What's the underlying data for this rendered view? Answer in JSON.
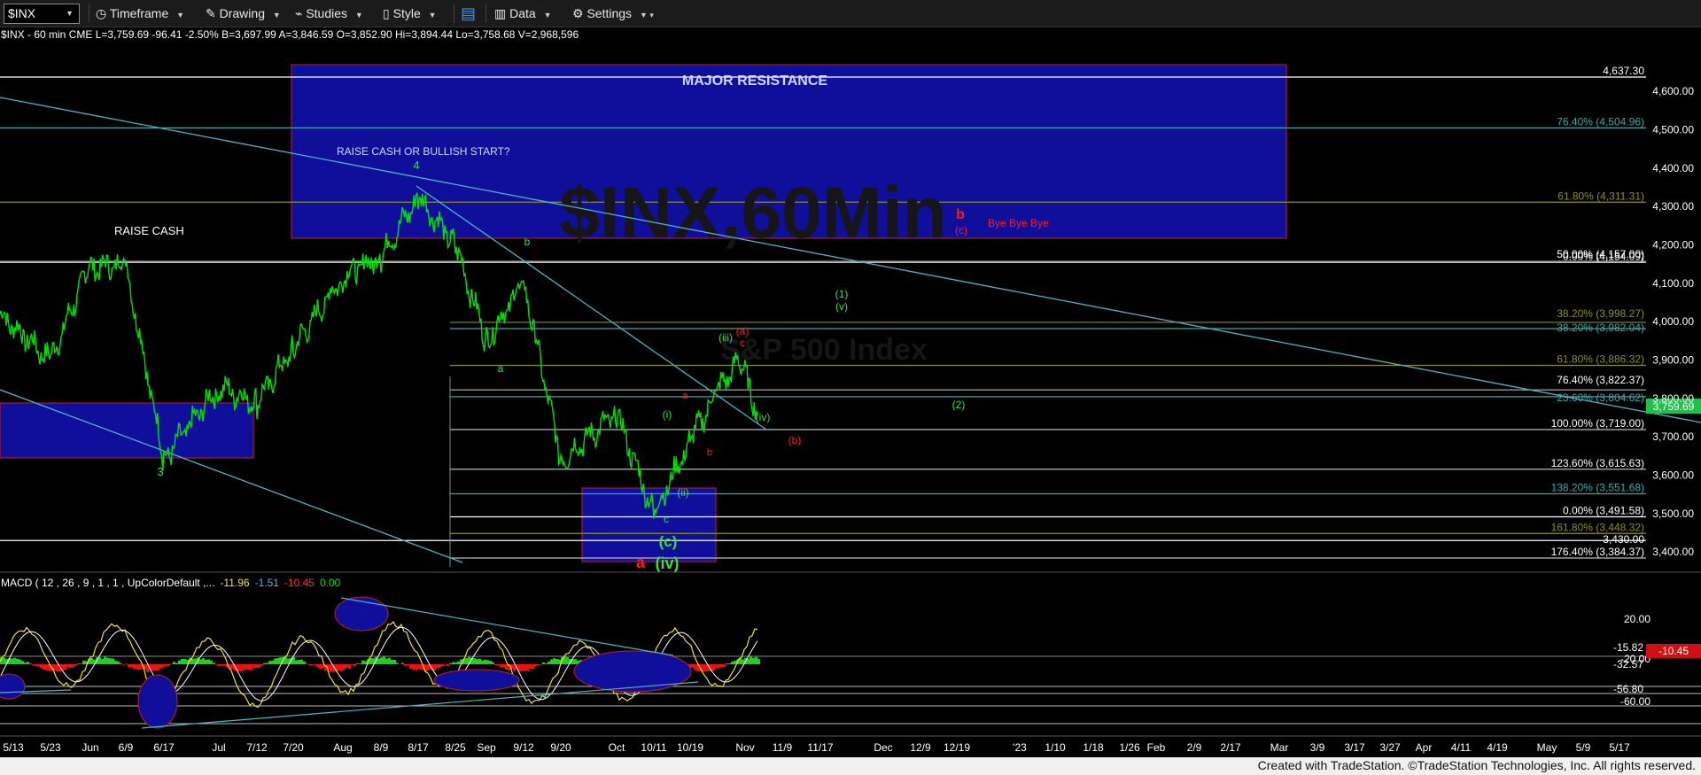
{
  "toolbar": {
    "symbol": "$INX",
    "timeframe": "Timeframe",
    "drawing": "Drawing",
    "studies": "Studies",
    "style": "Style",
    "data": "Data",
    "settings": "Settings"
  },
  "quote_line": "$INX - 60 min  CME  L=3,759.69  -96.41  -2.50%  B=3,697.99  A=3,846.59  O=3,852.90  Hi=3,894.44  Lo=3,758.68  V=2,968,596",
  "watermark": {
    "title": "$INX,60Min",
    "subtitle": "S&P 500 Index"
  },
  "colors": {
    "background": "#000000",
    "price": "#00e000",
    "resistance_box": "#0f0f9c",
    "trendline": "#4fb3c4",
    "fib_teal": "#3ca6a6",
    "fib_olive": "#8c8c2a",
    "label_red": "#ff1a1a",
    "label_green": "#3cdc3c",
    "current_price": "#1cc24a",
    "macd_line": "#f0e040",
    "signal_line": "#ffffff",
    "hist_pos": "#22cc22",
    "hist_neg": "#ee1111"
  },
  "chart_data": {
    "type": "line",
    "title": "$INX - 60 min",
    "series": [
      {
        "name": "$INX",
        "x": [
          "5/13",
          "5/23",
          "6/1",
          "6/9",
          "6/17",
          "7/1",
          "7/12",
          "7/20",
          "8/1",
          "8/9",
          "8/17",
          "8/25",
          "9/1",
          "9/12",
          "9/20",
          "10/1",
          "10/11",
          "10/19",
          "10/24",
          "10/31",
          "11/4"
        ],
        "values": [
          4020,
          3900,
          4140,
          4150,
          3640,
          3830,
          3790,
          3930,
          4120,
          4170,
          4325,
          4200,
          3950,
          4105,
          3640,
          3760,
          3500,
          3690,
          3820,
          3900,
          3759.69
        ]
      }
    ],
    "current_price": "3,759.69",
    "ylim": [
      3330,
      4700
    ],
    "y_ticks": [
      {
        "label": "4,600.00",
        "value": 4600
      },
      {
        "label": "4,500.00",
        "value": 4500
      },
      {
        "label": "4,400.00",
        "value": 4400
      },
      {
        "label": "4,300.00",
        "value": 4300
      },
      {
        "label": "4,200.00",
        "value": 4200
      },
      {
        "label": "4,100.00",
        "value": 4100
      },
      {
        "label": "4,000.00",
        "value": 4000
      },
      {
        "label": "3,900.00",
        "value": 3900
      },
      {
        "label": "3,800.00",
        "value": 3800
      },
      {
        "label": "3,700.00",
        "value": 3700
      },
      {
        "label": "3,600.00",
        "value": 3600
      },
      {
        "label": "3,500.00",
        "value": 3500
      },
      {
        "label": "3,400.00",
        "value": 3400
      }
    ],
    "x_ticks": [
      "5/13",
      "5/23",
      "Jun",
      "6/9",
      "6/17",
      "Jul",
      "7/12",
      "7/20",
      "Aug",
      "8/9",
      "8/17",
      "8/25",
      "Sep",
      "9/12",
      "9/20",
      "Oct",
      "10/11",
      "10/19",
      "Nov",
      "11/9",
      "11/17",
      "Dec",
      "12/9",
      "12/19",
      "'23",
      "1/10",
      "1/18",
      "1/26",
      "Feb",
      "2/9",
      "2/17",
      "Mar",
      "3/9",
      "3/17",
      "3/27",
      "Apr",
      "4/11",
      "4/19",
      "May",
      "5/9",
      "5/17"
    ],
    "fib_levels": [
      {
        "label": "4,637.30",
        "value": 4637.3,
        "color": "#ffffff"
      },
      {
        "label": "76.40% (4,504.96)",
        "value": 4504.96,
        "color": "#3ca6a6"
      },
      {
        "label": "61.80% (4,311.31)",
        "value": 4311.31,
        "color": "#8c8c2a"
      },
      {
        "label": "50.00% (4,157.00)",
        "value": 4157,
        "color": "#bbbbbb"
      },
      {
        "label": "0.00% (4,154.09)",
        "value": 4154.09,
        "color": "#bbbbbb"
      },
      {
        "label": "38.20% (3,998.27)",
        "value": 3998.27,
        "color": "#8c8c2a"
      },
      {
        "label": "38.20% (3,982.04)",
        "value": 3982.04,
        "color": "#3ca6a6"
      },
      {
        "label": "61.80% (3,886.32)",
        "value": 3886.32,
        "color": "#8c8c2a"
      },
      {
        "label": "76.40% (3,822.37)",
        "value": 3822.37,
        "color": "#bbbbbb"
      },
      {
        "label": "23.60% (3,804.62)",
        "value": 3804.62,
        "color": "#3ca6a6"
      },
      {
        "label": "100.00% (3,719.00)",
        "value": 3719,
        "color": "#bbbbbb"
      },
      {
        "label": "123.60% (3,615.63)",
        "value": 3615.63,
        "color": "#bbbbbb"
      },
      {
        "label": "138.20% (3,551.68)",
        "value": 3551.68,
        "color": "#3ca6a6"
      },
      {
        "label": "0.00% (3,491.58)",
        "value": 3491.58,
        "color": "#ffffff"
      },
      {
        "label": "161.80% (3,448.32)",
        "value": 3448.32,
        "color": "#8c8c2a"
      },
      {
        "label": "3,430.00",
        "value": 3430,
        "color": "#ffffff"
      },
      {
        "label": "176.40% (3,384.37)",
        "value": 3384.37,
        "color": "#bbbbbb"
      }
    ],
    "annotations": [
      {
        "text": "MAJOR RESISTANCE",
        "color": "#cfd8ff"
      },
      {
        "text": "RAISE CASH OR BULLISH START?",
        "color": "#cfd8ff"
      },
      {
        "text": "RAISE CASH",
        "color": "#ffffff"
      },
      {
        "text": "Bye Bye Bye",
        "color": "#ff1a1a"
      }
    ],
    "wave_labels": [
      {
        "text": "3",
        "color": "#3cdc3c"
      },
      {
        "text": "4",
        "color": "#3cdc3c"
      },
      {
        "text": "b",
        "color": "#3cdc3c"
      },
      {
        "text": "a",
        "color": "#3cdc3c"
      },
      {
        "text": "(i)",
        "color": "#3cdc3c"
      },
      {
        "text": "(ii)",
        "color": "#3cdc3c"
      },
      {
        "text": "(iii)",
        "color": "#3cdc3c"
      },
      {
        "text": "(iv)",
        "color": "#3cdc3c"
      },
      {
        "text": "(1)",
        "color": "#3cdc3c"
      },
      {
        "text": "(v)",
        "color": "#3cdc3c"
      },
      {
        "text": "(2)",
        "color": "#3cdc3c"
      },
      {
        "text": "c",
        "color": "#3cdc3c"
      },
      {
        "text": "(c)",
        "color": "#3cdc3c"
      },
      {
        "text": "(iv)",
        "color": "#3cdc3c"
      },
      {
        "text": "a",
        "color": "#ff1a1a"
      },
      {
        "text": "b",
        "color": "#ff1a1a"
      },
      {
        "text": "a",
        "color": "#ff1a1a"
      },
      {
        "text": "(a)",
        "color": "#ff1a1a"
      },
      {
        "text": "c",
        "color": "#ff1a1a"
      },
      {
        "text": "(b)",
        "color": "#ff1a1a"
      },
      {
        "text": "b",
        "color": "#ff1a1a"
      },
      {
        "text": "(c)",
        "color": "#ff1a1a"
      }
    ]
  },
  "macd": {
    "legend_prefix": "MACD ( 12 , 26 , 9 , 1 , 1 , UpColorDefault ,...",
    "values": [
      "-11.96",
      "-1.51",
      "-10.45",
      "0.00"
    ],
    "axis_labels": [
      "20.00",
      "-15.82",
      "-20.00",
      "-32.57",
      "-56.80",
      "-60.00"
    ],
    "current_badge": "-10.45"
  },
  "footer": "Created with TradeStation. ©TradeStation Technologies, Inc. All rights reserved."
}
